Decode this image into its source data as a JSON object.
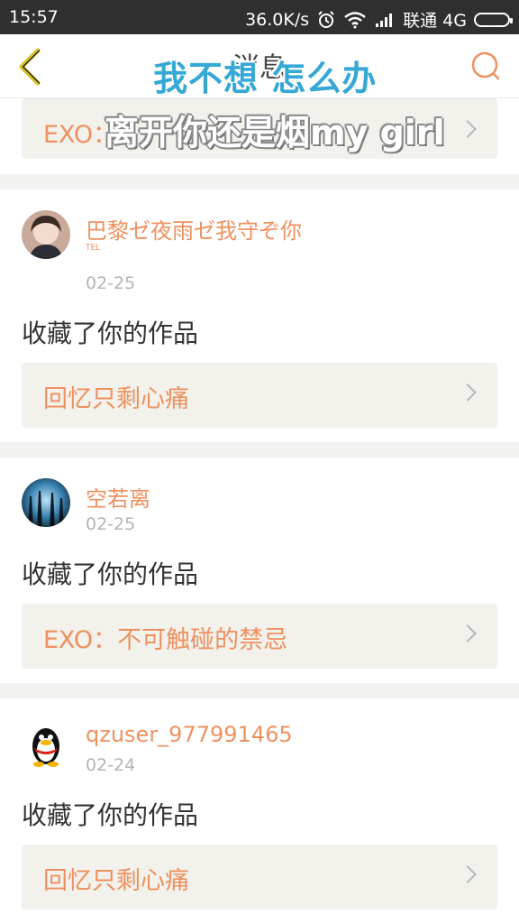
{
  "status_bar": {
    "time": "15:57",
    "speed": "36.0K/s",
    "carrier": "联通 4G"
  },
  "nav": {
    "title": "消息"
  },
  "overlays": {
    "line1": "我不想 怎么办",
    "line2": "离开你还是烟my girl"
  },
  "top_card": {
    "work_title": "EXO："
  },
  "messages": [
    {
      "username": "巴黎ゼ夜雨ゼ我守ぞ你",
      "tag": "TEL",
      "date": "02-25",
      "action": "收藏了你的作品",
      "work_title": "回忆只剩心痛"
    },
    {
      "username": "空若离",
      "date": "02-25",
      "action": "收藏了你的作品",
      "work_title": "EXO：不可触碰的禁忌"
    },
    {
      "username": "qzuser_977991465",
      "date": "02-24",
      "action": "收藏了你的作品",
      "work_title": "回忆只剩心痛"
    }
  ],
  "colors": {
    "accent": "#ee9160",
    "chip_bg": "#f2f1eb",
    "status_bg": "#2f2f2f"
  }
}
